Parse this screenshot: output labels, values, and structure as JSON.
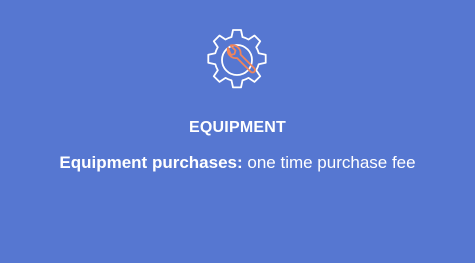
{
  "card": {
    "icon": "gear-wrench-icon",
    "title": "EQUIPMENT",
    "description_lead": "Equipment purchases:",
    "description_rest": " one time purchase fee"
  },
  "colors": {
    "background": "#5677d1",
    "text": "#ffffff",
    "icon_outline": "#ffffff",
    "icon_accent": "#f0845a"
  }
}
